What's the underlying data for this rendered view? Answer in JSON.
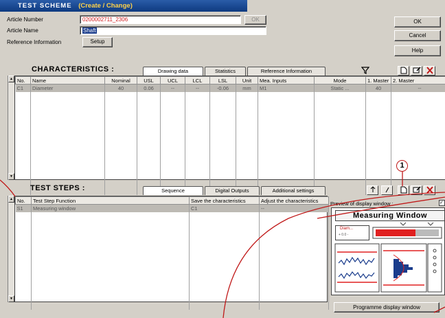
{
  "title": {
    "main": "TEST SCHEME",
    "sub": "(Create / Change)"
  },
  "header": {
    "article_number_label": "Article Number",
    "article_number_value": "0200002711_2306",
    "ok_small_label": "OK",
    "article_name_label": "Article Name",
    "article_name_value": "Shaft",
    "reference_label": "Reference Information",
    "setup_label": "Setup"
  },
  "dialog_buttons": {
    "ok": "OK",
    "cancel": "Cancel",
    "help": "Help"
  },
  "characteristics": {
    "title": "CHARACTERISTICS :",
    "tabs": [
      "Drawing data",
      "Statistics",
      "Reference Information"
    ],
    "columns": [
      "No.",
      "Name",
      "Nominal",
      "USL",
      "UCL",
      "LCL",
      "LSL",
      "Unit",
      "Mea. Inputs",
      "Mode",
      "1. Master",
      "2. Master"
    ],
    "rows": [
      [
        "C1",
        "Diameter",
        "40",
        "0.06",
        "--",
        "--",
        "-0.06",
        "mm",
        "M1",
        "Static ...",
        "40",
        "--"
      ]
    ]
  },
  "test_steps": {
    "title": "TEST  STEPS :",
    "tabs": [
      "Sequence",
      "Digital Outputs",
      "Additional settings"
    ],
    "columns": [
      "No.",
      "Test Step Function",
      "Save the characteristics",
      "Adjust the characteristics"
    ],
    "rows": [
      [
        "S1",
        "Measuring window",
        "C1",
        "--"
      ]
    ]
  },
  "preview": {
    "label": "Preview of display window :",
    "window_title": "Measuring Window",
    "mini_label": "Diam...",
    "mini_values": "+   0.0   -",
    "program_button": "Programme display window"
  },
  "callout_number": "1",
  "colors": {
    "accent": "#c01818",
    "titlebar": "#1a4b98",
    "selection": "#1a3c8c"
  }
}
